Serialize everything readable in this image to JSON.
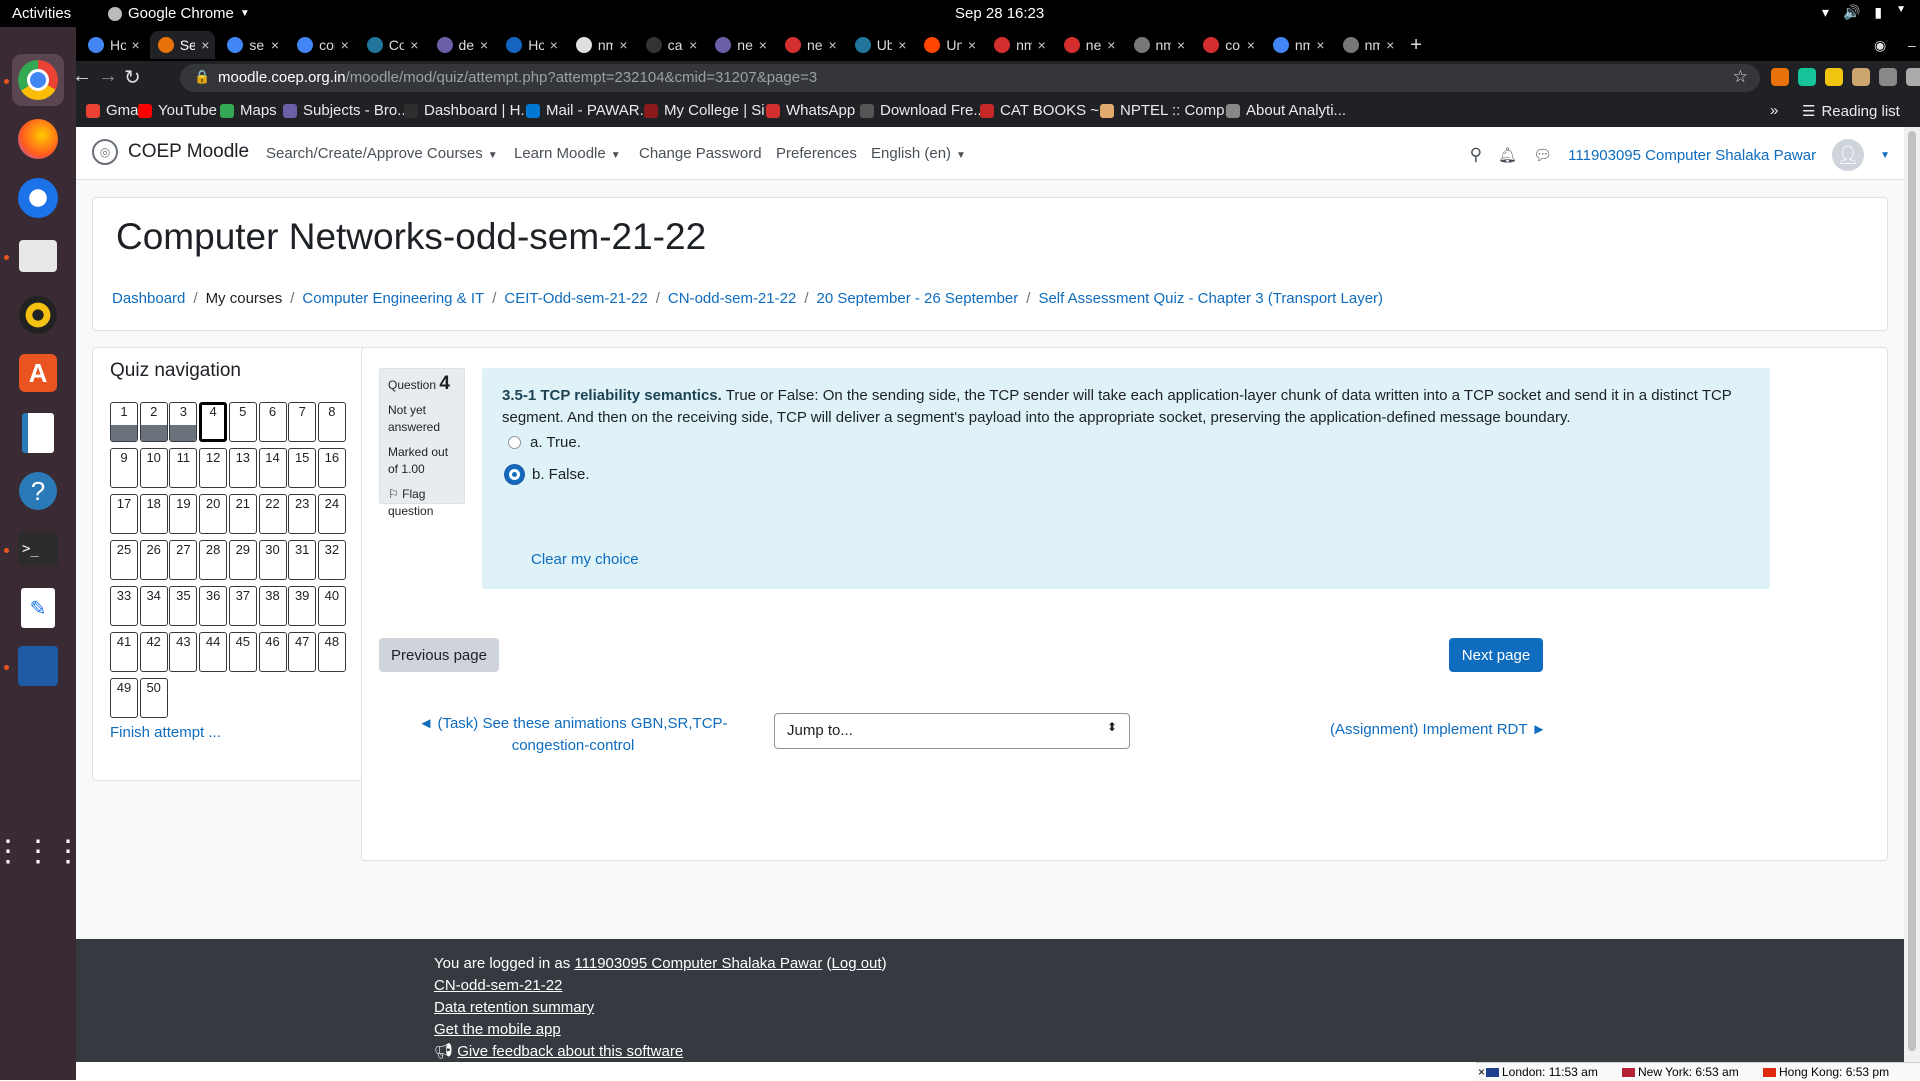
{
  "system": {
    "activities": "Activities",
    "app_name": "Google Chrome",
    "clock": "Sep 28  16:23"
  },
  "tabs": [
    {
      "label": "Ho",
      "icon_color": "#4285f4"
    },
    {
      "label": "Sel",
      "icon_color": "#e8710a"
    },
    {
      "label": "sel",
      "icon_color": "#4285f4"
    },
    {
      "label": "cor",
      "icon_color": "#4285f4"
    },
    {
      "label": "Co",
      "icon_color": "#21759b"
    },
    {
      "label": "del",
      "icon_color": "#6b5fa8"
    },
    {
      "label": "Ho",
      "icon_color": "#1565c0"
    },
    {
      "label": "nm",
      "icon_color": "#e0e0e0"
    },
    {
      "label": "car",
      "icon_color": "#333333"
    },
    {
      "label": "net",
      "icon_color": "#6b5fa8"
    },
    {
      "label": "net",
      "icon_color": "#d32f2f"
    },
    {
      "label": "Ub",
      "icon_color": "#21759b"
    },
    {
      "label": "Un",
      "icon_color": "#ff4500"
    },
    {
      "label": "nm",
      "icon_color": "#d32f2f"
    },
    {
      "label": "net",
      "icon_color": "#d32f2f"
    },
    {
      "label": "nm",
      "icon_color": "#777777"
    },
    {
      "label": "cor",
      "icon_color": "#d32f2f"
    },
    {
      "label": "nm",
      "icon_color": "#4285f4"
    },
    {
      "label": "nm",
      "icon_color": "#777777"
    }
  ],
  "url": {
    "host": "moodle.coep.org.in",
    "path": "/moodle/mod/quiz/attempt.php?attempt=232104&cmid=31207&page=3"
  },
  "bookmarks": [
    {
      "label": "Gmail",
      "color": "#ea4335"
    },
    {
      "label": "YouTube",
      "color": "#ff0000"
    },
    {
      "label": "Maps",
      "color": "#34a853"
    },
    {
      "label": "Subjects - Bro...",
      "color": "#6b5fa8"
    },
    {
      "label": "Dashboard | H...",
      "color": "#2e2e2e"
    },
    {
      "label": "Mail - PAWAR...",
      "color": "#0078d4"
    },
    {
      "label": "My College | Si...",
      "color": "#8b1a1a"
    },
    {
      "label": "WhatsApp",
      "color": "#d32f2f"
    },
    {
      "label": "Download Fre...",
      "color": "#555555"
    },
    {
      "label": "CAT BOOKS ~...",
      "color": "#c62828"
    },
    {
      "label": "NPTEL :: Comp...",
      "color": "#e0a96d"
    },
    {
      "label": "About Analyti...",
      "color": "#888888"
    }
  ],
  "reading_list": "Reading list",
  "moodle_nav": {
    "brand": "COEP Moodle",
    "links": [
      "Search/Create/Approve Courses",
      "Learn Moodle",
      "Change Password",
      "Preferences",
      "English (en)"
    ],
    "user": "111903095 Computer Shalaka Pawar"
  },
  "course_title": "Computer Networks-odd-sem-21-22",
  "breadcrumb": [
    "Dashboard",
    "My courses",
    "Computer Engineering & IT",
    "CEIT-Odd-sem-21-22",
    "CN-odd-sem-21-22",
    "20 September - 26 September",
    "Self Assessment Quiz - Chapter 3 (Transport Layer)"
  ],
  "quiz_nav": {
    "title": "Quiz navigation",
    "answered": [
      "1",
      "2",
      "3"
    ],
    "current": "4",
    "questions": [
      "1",
      "2",
      "3",
      "4",
      "5",
      "6",
      "7",
      "8",
      "9",
      "10",
      "11",
      "12",
      "13",
      "14",
      "15",
      "16",
      "17",
      "18",
      "19",
      "20",
      "21",
      "22",
      "23",
      "24",
      "25",
      "26",
      "27",
      "28",
      "29",
      "30",
      "31",
      "32",
      "33",
      "34",
      "35",
      "36",
      "37",
      "38",
      "39",
      "40",
      "41",
      "42",
      "43",
      "44",
      "45",
      "46",
      "47",
      "48",
      "49",
      "50"
    ],
    "finish": "Finish attempt ..."
  },
  "question": {
    "label": "Question",
    "number": "4",
    "status": "Not yet answered",
    "marks": "Marked out of 1.00",
    "flag": "Flag question",
    "title": "3.5-1 TCP reliability semantics.",
    "text": " True or False:  On the sending side, the TCP sender will take each application-layer chunk of data written into a TCP socket and send it in a distinct TCP segment. And then on the receiving side, TCP will deliver a segment's payload into the appropriate socket, preserving the application-defined message boundary.",
    "options": [
      {
        "label": "a. True.",
        "selected": false
      },
      {
        "label": "b. False.",
        "selected": true
      }
    ],
    "clear": "Clear my choice"
  },
  "buttons": {
    "previous": "Previous page",
    "next": "Next page"
  },
  "activity_nav": {
    "prev": "◄ (Task) See these animations GBN,SR,TCP-congestion-control",
    "jump": "Jump to...",
    "next": "(Assignment) Implement RDT ►"
  },
  "footer": {
    "logged_in_prefix": "You are logged in as ",
    "user": "111903095 Computer Shalaka Pawar",
    "logout": "Log out",
    "course": "CN-odd-sem-21-22",
    "retention": "Data retention summary",
    "mobile": "Get the mobile app",
    "feedback": "Give feedback about this software"
  },
  "clocks": [
    "London: 11:53 am",
    "New York: 6:53 am",
    "Hong Kong: 6:53 pm"
  ]
}
